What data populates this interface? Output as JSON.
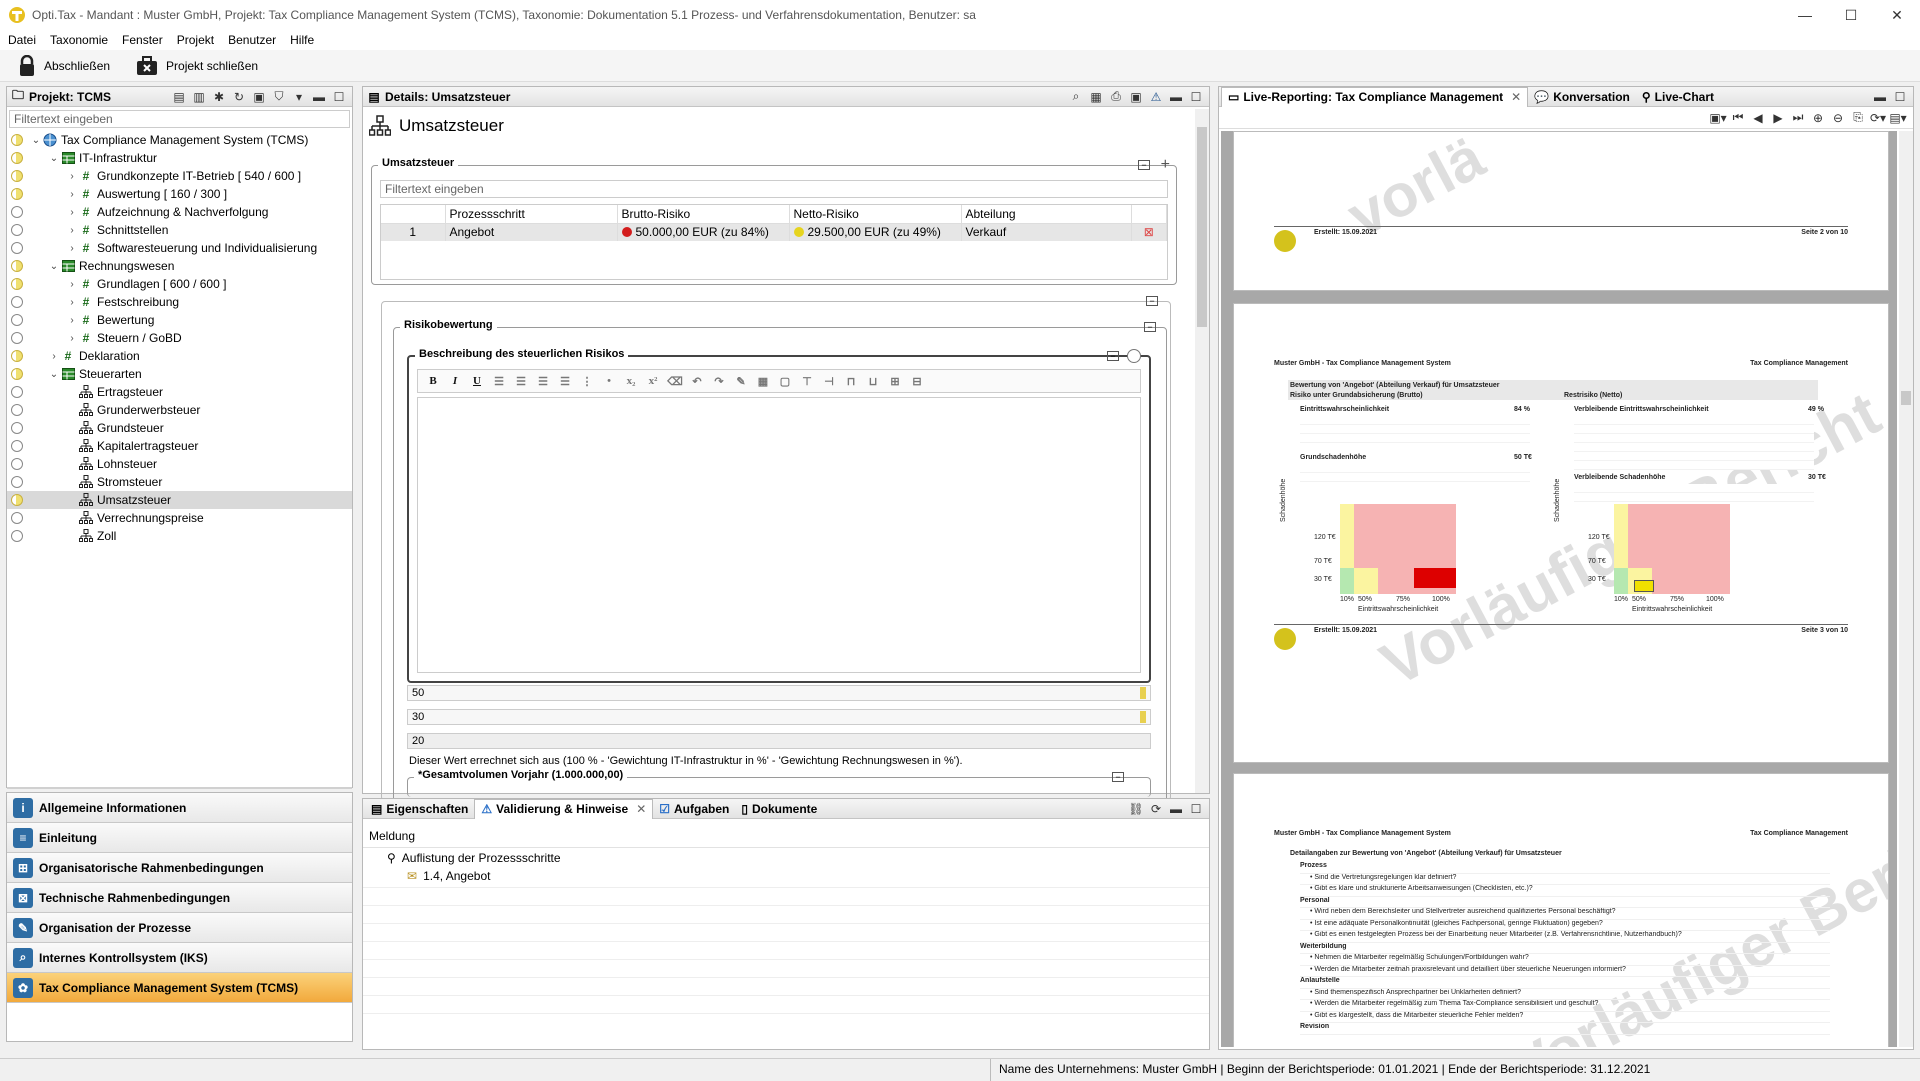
{
  "window": {
    "title": "Opti.Tax - Mandant : Muster GmbH, Projekt: Tax Compliance Management System (TCMS), Taxonomie: Dokumentation 5.1 Prozess- und Verfahrensdokumentation, Benutzer: sa"
  },
  "menu": [
    "Datei",
    "Taxonomie",
    "Fenster",
    "Projekt",
    "Benutzer",
    "Hilfe"
  ],
  "toolbar": {
    "close": "Abschließen",
    "close_project": "Projekt schließen"
  },
  "left_panel": {
    "title": "Projekt: TCMS",
    "filter_placeholder": "Filtertext eingeben",
    "tree": [
      {
        "label": "Tax Compliance Management System (TCMS)",
        "level": 0,
        "icon": "globe-icon",
        "status": "y",
        "expand": "open"
      },
      {
        "label": "IT-Infrastruktur",
        "level": 1,
        "icon": "table-icon",
        "status": "y",
        "expand": "open"
      },
      {
        "label": "Grundkonzepte IT-Betrieb  [ 540 / 600 ]",
        "level": 2,
        "icon": "hash-icon",
        "status": "y",
        "expand": "closed"
      },
      {
        "label": "Auswertung  [ 160 / 300 ]",
        "level": 2,
        "icon": "hash-icon",
        "status": "y",
        "expand": "closed"
      },
      {
        "label": "Aufzeichnung & Nachverfolgung",
        "level": 2,
        "icon": "hash-icon",
        "status": "o",
        "expand": "closed"
      },
      {
        "label": "Schnittstellen",
        "level": 2,
        "icon": "hash-icon",
        "status": "o",
        "expand": "closed"
      },
      {
        "label": "Softwaresteuerung und Individualisierung",
        "level": 2,
        "icon": "hash-icon",
        "status": "o",
        "expand": "closed"
      },
      {
        "label": "Rechnungswesen",
        "level": 1,
        "icon": "table-icon",
        "status": "y",
        "expand": "open"
      },
      {
        "label": "Grundlagen  [ 600 / 600 ]",
        "level": 2,
        "icon": "hash-icon",
        "status": "y",
        "expand": "closed"
      },
      {
        "label": "Festschreibung",
        "level": 2,
        "icon": "hash-icon",
        "status": "o",
        "expand": "closed"
      },
      {
        "label": "Bewertung",
        "level": 2,
        "icon": "hash-icon",
        "status": "o",
        "expand": "closed"
      },
      {
        "label": "Steuern / GoBD",
        "level": 2,
        "icon": "hash-icon",
        "status": "o",
        "expand": "closed"
      },
      {
        "label": "Deklaration",
        "level": 1,
        "icon": "hash-icon",
        "status": "y",
        "expand": "closed"
      },
      {
        "label": "Steuerarten",
        "level": 1,
        "icon": "table-icon",
        "status": "y",
        "expand": "open"
      },
      {
        "label": "Ertragsteuer",
        "level": 2,
        "icon": "process-icon",
        "status": "o",
        "expand": "none"
      },
      {
        "label": "Grunderwerbsteuer",
        "level": 2,
        "icon": "process-icon",
        "status": "o",
        "expand": "none"
      },
      {
        "label": "Grundsteuer",
        "level": 2,
        "icon": "process-icon",
        "status": "o",
        "expand": "none"
      },
      {
        "label": "Kapitalertragsteuer",
        "level": 2,
        "icon": "process-icon",
        "status": "o",
        "expand": "none"
      },
      {
        "label": "Lohnsteuer",
        "level": 2,
        "icon": "process-icon",
        "status": "o",
        "expand": "none"
      },
      {
        "label": "Stromsteuer",
        "level": 2,
        "icon": "process-icon",
        "status": "o",
        "expand": "none"
      },
      {
        "label": "Umsatzsteuer",
        "level": 2,
        "icon": "process-icon",
        "status": "y",
        "expand": "none",
        "selected": true
      },
      {
        "label": "Verrechnungspreise",
        "level": 2,
        "icon": "process-icon",
        "status": "o",
        "expand": "none"
      },
      {
        "label": "Zoll",
        "level": 2,
        "icon": "process-icon",
        "status": "o",
        "expand": "none"
      }
    ],
    "nav": [
      {
        "label": "Allgemeine Informationen",
        "icon": "info-icon",
        "glyph": "i"
      },
      {
        "label": "Einleitung",
        "icon": "document-icon",
        "glyph": "≡"
      },
      {
        "label": "Organisatorische Rahmenbedingungen",
        "icon": "org-icon",
        "glyph": "⊞"
      },
      {
        "label": "Technische Rahmenbedingungen",
        "icon": "network-icon",
        "glyph": "⊠"
      },
      {
        "label": "Organisation der Prozesse",
        "icon": "edit-icon",
        "glyph": "✎"
      },
      {
        "label": "Internes Kontrollsystem (IKS)",
        "icon": "search-icon",
        "glyph": "⌕"
      },
      {
        "label": "Tax Compliance Management System (TCMS)",
        "icon": "tcms-icon",
        "glyph": "✿",
        "active": true
      }
    ]
  },
  "details": {
    "panel_title": "Details: Umsatzsteuer",
    "heading": "Umsatzsteuer",
    "group_label": "Umsatzsteuer",
    "filter_placeholder": "Filtertext eingeben",
    "table": {
      "headers": [
        "Prozessschritt",
        "Brutto-Risiko",
        "Netto-Risiko",
        "Abteilung"
      ],
      "rows": [
        {
          "num": "1",
          "step": "Angebot",
          "brutto": "50.000,00 EUR (zu 84%)",
          "netto": "29.500,00 EUR (zu 49%)",
          "dept": "Verkauf"
        }
      ]
    },
    "risk_label": "Risikobewertung",
    "desc_label": "Beschreibung des steuerlichen Risikos",
    "editor_buttons": [
      "B",
      "I",
      "U"
    ],
    "values": [
      "50",
      "30",
      "20"
    ],
    "hint": "Dieser Wert errechnet sich aus (100 % - 'Gewichtung IT-Infrastruktur in %' - 'Gewichtung Rechnungswesen in %').",
    "volume_label": "*Gesamtvolumen Vorjahr (1.000.000,00)"
  },
  "bottom": {
    "tabs": [
      "Eigenschaften",
      "Validierung & Hinweise",
      "Aufgaben",
      "Dokumente"
    ],
    "header": "Meldung",
    "items": [
      "Auflistung der Prozessschritte",
      "1.4, Angebot"
    ]
  },
  "report": {
    "tabs": [
      "Live-Reporting: Tax Compliance Management",
      "Konversation",
      "Live-Chart"
    ],
    "watermark1": "vorlä",
    "watermark2": "Vorläufiger Bericht",
    "page2": {
      "created": "Erstellt: 15.09.2021",
      "page": "Seite 2 von 10"
    },
    "page3": {
      "company": "Muster GmbH - Tax Compliance Management System",
      "right": "Tax Compliance Management",
      "subtitle": "Bewertung von 'Angebot' (Abteilung Verkauf) für Umsatzsteuer",
      "left_title": "Risiko unter Grundabsicherung (Brutto)",
      "right_title": "Restrisiko (Netto)",
      "l1": "Eintrittswahrscheinlichkeit",
      "l1v": "84 %",
      "l2": "Grundschadenhöhe",
      "l2v": "50 T€",
      "r1": "Verbleibende Eintrittswahrscheinlichkeit",
      "r1v": "49 %",
      "r2": "Verbleibende Schadenhöhe",
      "r2v": "30 T€",
      "y_ticks": [
        "120 T€",
        "70 T€",
        "30 T€"
      ],
      "x_ticks": [
        "10%",
        "50%",
        "75%",
        "100%"
      ],
      "xlabel": "Eintrittswahrscheinlichkeit",
      "ylabel": "Schadenhöhe",
      "created": "Erstellt: 15.09.2021",
      "page": "Seite 3 von 10"
    },
    "page4": {
      "company": "Muster GmbH - Tax Compliance Management System",
      "right": "Tax Compliance Management",
      "subtitle": "Detailangaben zur Bewertung von 'Angebot' (Abteilung Verkauf) für Umsatzsteuer",
      "lines": [
        "Prozess",
        "• Sind die Vertretungsregelungen klar definiert?",
        "• Gibt es klare und strukturierte Arbeitsanweisungen (Checklisten, etc.)?",
        "Personal",
        "• Wird neben dem Bereichsleiter und Stellvertreter ausreichend qualifiziertes Personal beschäftigt?",
        "• Ist eine adäquate Personalkontinuität (gleiches Fachpersonal, geringe Fluktuation) gegeben?",
        "• Gibt es einen festgelegten Prozess bei der Einarbeitung neuer Mitarbeiter (z.B. Verfahrensrichtlinie, Nutzerhandbuch)?",
        "Weiterbildung",
        "• Nehmen die Mitarbeiter regelmäßig Schulungen/Fortbildungen wahr?",
        "• Werden die Mitarbeiter zeitnah praxisrelevant und detailliert über steuerliche Neuerungen informiert?",
        "Anlaufstelle",
        "• Sind themenspezifisch Ansprechpartner bei Unklarheiten definiert?",
        "• Werden die Mitarbeiter regelmäßig zum Thema Tax-Compliance sensibilisiert und geschult?",
        "• Gibt es klargestellt, dass die Mitarbeiter steuerliche Fehler melden?",
        "Revision"
      ]
    }
  },
  "statusbar": "Name des Unternehmens: Muster GmbH | Beginn der Berichtsperiode: 01.01.2021 | Ende der Berichtsperiode: 31.12.2021"
}
